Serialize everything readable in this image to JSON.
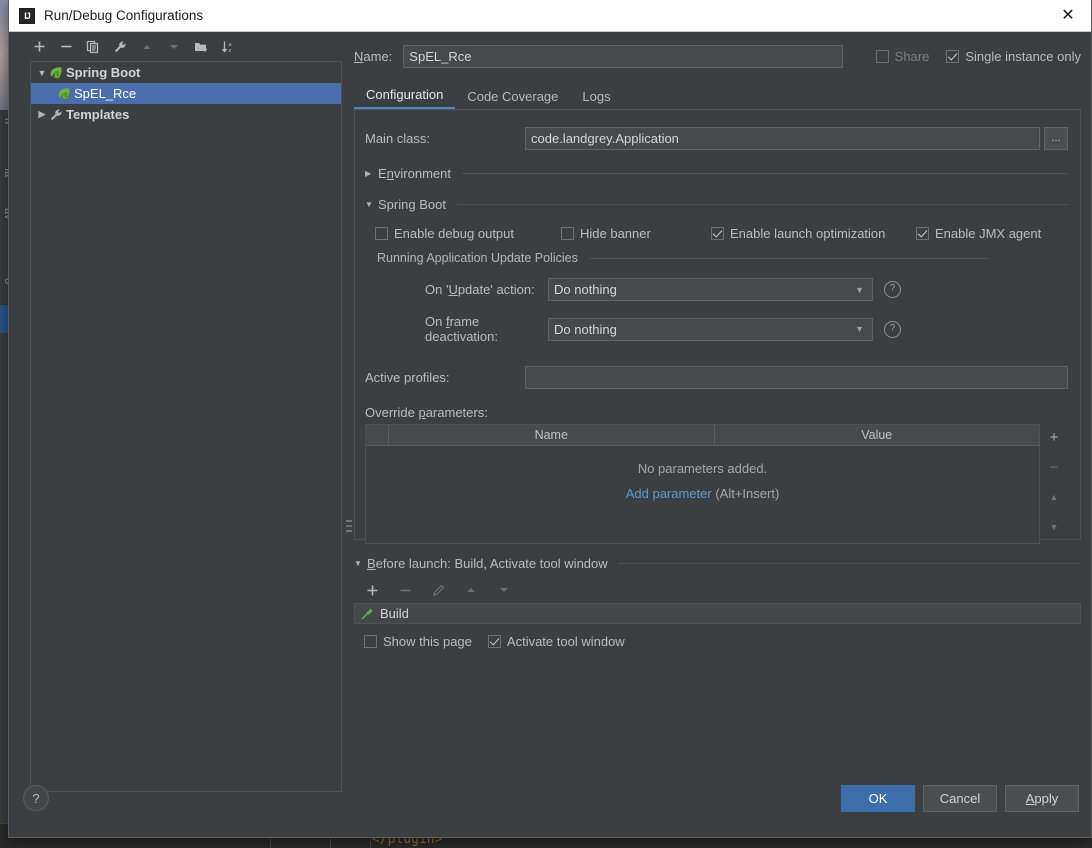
{
  "background": {
    "side_tabs": [
      "ri",
      "fa",
      "av",
      "o"
    ],
    "code_fragment": "</plugin>"
  },
  "window": {
    "title": "Run/Debug Configurations",
    "app_icon": "intellij-idea-icon",
    "close_icon": "close-icon"
  },
  "tree_toolbar": {
    "items": [
      {
        "name": "add-configuration-button",
        "glyph": "+",
        "enabled": true
      },
      {
        "name": "remove-configuration-button",
        "glyph": "−",
        "enabled": true
      },
      {
        "name": "copy-configuration-button",
        "glyph": "copy-icon",
        "enabled": true
      },
      {
        "name": "edit-templates-button",
        "glyph": "wrench-icon",
        "enabled": true
      },
      {
        "name": "move-up-button",
        "glyph": "▲",
        "enabled": false
      },
      {
        "name": "move-down-button",
        "glyph": "▼",
        "enabled": false
      },
      {
        "name": "move-into-folder-button",
        "glyph": "folder-add-icon",
        "enabled": true
      },
      {
        "name": "sort-configurations-button",
        "glyph": "sort-az-icon",
        "enabled": true
      }
    ]
  },
  "tree": {
    "nodes": [
      {
        "label": "Spring Boot",
        "type": "group",
        "expanded": true,
        "icon": "spring-boot-leaf-icon",
        "selected": false
      },
      {
        "label": "SpEL_Rce",
        "type": "child",
        "icon": "spring-boot-leaf-icon",
        "selected": true
      },
      {
        "label": "Templates",
        "type": "group",
        "expanded": false,
        "icon": "wrench-icon",
        "selected": false
      }
    ]
  },
  "header": {
    "name_label": "Name:",
    "name_value": "SpEL_Rce",
    "name_placeholder": "",
    "share": {
      "label": "Share",
      "checked": false,
      "enabled": false
    },
    "single_instance": {
      "label": "Single instance only",
      "checked": true
    }
  },
  "tabs": [
    {
      "label": "Configuration",
      "active": true
    },
    {
      "label": "Code Coverage",
      "active": false
    },
    {
      "label": "Logs",
      "active": false
    }
  ],
  "configuration": {
    "main_class": {
      "label": "Main class:",
      "value": "code.landgrey.Application",
      "placeholder": "",
      "browse_label": "..."
    },
    "environment_section": {
      "label": "Environment",
      "expanded": false,
      "arrow": "▶"
    },
    "spring_boot_section": {
      "label": "Spring Boot",
      "expanded": true,
      "arrow": "▼"
    },
    "spring_boot_checks": [
      {
        "label": "Enable debug output",
        "checked": false,
        "name": "enable-debug-output-checkbox"
      },
      {
        "label": "Hide banner",
        "checked": false,
        "name": "hide-banner-checkbox"
      },
      {
        "label": "Enable launch optimization",
        "checked": true,
        "name": "enable-launch-optimization-checkbox"
      },
      {
        "label": "Enable JMX agent",
        "checked": true,
        "name": "enable-jmx-agent-checkbox"
      }
    ],
    "update_policies_label": "Running Application Update Policies",
    "on_update_action": {
      "label": "On 'Update' action:",
      "value": "Do nothing"
    },
    "on_frame_deactivation": {
      "label": "On frame deactivation:",
      "value": "Do nothing"
    },
    "active_profiles": {
      "label": "Active profiles:",
      "value": "",
      "placeholder": ""
    },
    "override_parameters": {
      "label": "Override parameters:",
      "columns": [
        "",
        "Name",
        "Value"
      ],
      "rows": [],
      "empty_message": "No parameters added.",
      "add_link": "Add parameter",
      "add_shortcut": "(Alt+Insert)",
      "side_buttons": [
        {
          "name": "add-parameter-button",
          "glyph": "+",
          "enabled": true
        },
        {
          "name": "remove-parameter-button",
          "glyph": "−",
          "enabled": false
        },
        {
          "name": "move-parameter-up-button",
          "glyph": "▲",
          "enabled": false
        },
        {
          "name": "move-parameter-down-button",
          "glyph": "▼",
          "enabled": false
        }
      ]
    }
  },
  "before_launch": {
    "header": "Before launch: Build, Activate tool window",
    "arrow": "▼",
    "toolbar": [
      {
        "name": "add-task-button",
        "glyph": "+",
        "enabled": true
      },
      {
        "name": "remove-task-button",
        "glyph": "−",
        "enabled": false
      },
      {
        "name": "edit-task-button",
        "glyph": "pencil-icon",
        "enabled": false
      },
      {
        "name": "move-task-up-button",
        "glyph": "▲",
        "enabled": false
      },
      {
        "name": "move-task-down-button",
        "glyph": "▼",
        "enabled": false
      }
    ],
    "tasks": [
      {
        "label": "Build",
        "icon": "build-hammer-icon"
      }
    ],
    "show_this_page": {
      "label": "Show this page",
      "checked": false
    },
    "activate_tool_window": {
      "label": "Activate tool window",
      "checked": true
    }
  },
  "footer": {
    "help_label": "?",
    "buttons": [
      {
        "label": "OK",
        "primary": true,
        "name": "ok-button"
      },
      {
        "label": "Cancel",
        "primary": false,
        "name": "cancel-button"
      },
      {
        "label": "Apply",
        "primary": false,
        "name": "apply-button"
      }
    ]
  },
  "colors": {
    "dialog_bg": "#3c3f41",
    "field_bg": "#45494a",
    "selection_blue": "#4b6eaf",
    "accent_blue": "#4a88c7",
    "link_blue": "#5b9bd5",
    "primary_button": "#3b6eab",
    "spring_green": "#6db33f"
  }
}
